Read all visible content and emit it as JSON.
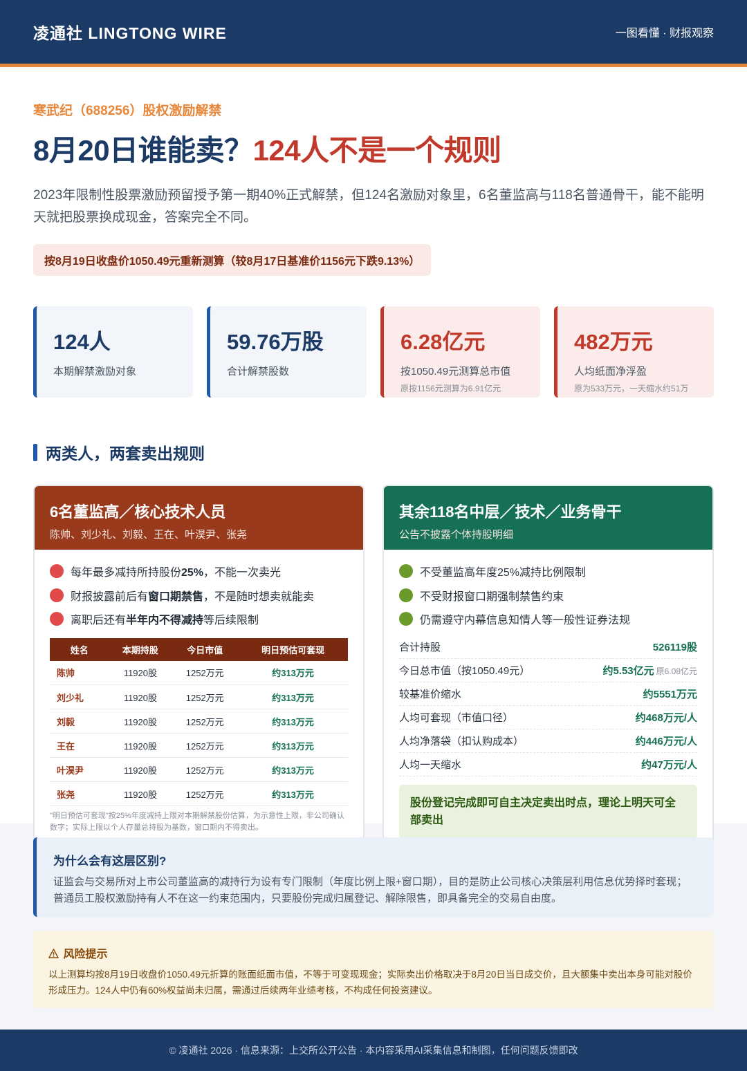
{
  "header": {
    "brand": "凌通社 LINGTONG WIRE",
    "tagline": "一图看懂 · 财报观察"
  },
  "hero": {
    "kicker": "寒武纪（688256）股权激励解禁",
    "headline_main": "8月20日谁能卖？",
    "headline_accent": "124人不是一个规则",
    "lede": "2023年限制性股票激励预留授予第一期40%正式解禁，但124名激励对象里，6名董监高与118名普通骨干，能不能明天就把股票换成现金，答案完全不同。",
    "note": "按8月19日收盘价1050.49元重新测算（较8月17日基准价1156元下跌9.13%）"
  },
  "stats": [
    {
      "value": "124人",
      "label": "本期解禁激励对象",
      "sub": ""
    },
    {
      "value": "59.76万股",
      "label": "合计解禁股数",
      "sub": ""
    },
    {
      "value": "6.28亿元",
      "label": "按1050.49元测算总市值",
      "sub": "原按1156元测算为6.91亿元"
    },
    {
      "value": "482万元",
      "label": "人均纸面净浮盈",
      "sub": "原为533万元，一天缩水约51万"
    }
  ],
  "section_title": "两类人，两套卖出规则",
  "left_card": {
    "title": "6名董监高／核心技术人员",
    "subtitle": "陈帅、刘少礼、刘毅、王在、叶淏尹、张尧",
    "bullets": [
      {
        "pre": "每年最多减持所持股份",
        "bold": "25%",
        "post": "，不能一次卖光"
      },
      {
        "pre": "财报披露前后有",
        "bold": "窗口期禁售",
        "post": "，不是随时想卖就能卖"
      },
      {
        "pre": "离职后还有",
        "bold": "半年内不得减持",
        "post": "等后续限制"
      }
    ],
    "table_headers": [
      "姓名",
      "本期持股",
      "今日市值",
      "明日预估可套现"
    ],
    "table_rows": [
      {
        "name": "陈帅",
        "shares": "11920股",
        "value": "1252万元",
        "cash": "约313万元"
      },
      {
        "name": "刘少礼",
        "shares": "11920股",
        "value": "1252万元",
        "cash": "约313万元"
      },
      {
        "name": "刘毅",
        "shares": "11920股",
        "value": "1252万元",
        "cash": "约313万元"
      },
      {
        "name": "王在",
        "shares": "11920股",
        "value": "1252万元",
        "cash": "约313万元"
      },
      {
        "name": "叶淏尹",
        "shares": "11920股",
        "value": "1252万元",
        "cash": "约313万元"
      },
      {
        "name": "张尧",
        "shares": "11920股",
        "value": "1252万元",
        "cash": "约313万元"
      }
    ],
    "table_note": "\"明日预估可套现\"按25%年度减持上限对本期解禁股份估算，为示意性上限，非公司确认数字；实际上限以个人存量总持股为基数，窗口期内不得卖出。"
  },
  "right_card": {
    "title": "其余118名中层／技术／业务骨干",
    "subtitle": "公告不披露个体持股明细",
    "bullets": [
      "不受董监高年度25%减持比例限制",
      "不受财报窗口期强制禁售约束",
      "仍需遵守内幕信息知情人等一般性证券法规"
    ],
    "metrics": [
      {
        "label": "合计持股",
        "value": "526119股",
        "note": ""
      },
      {
        "label": "今日总市值（按1050.49元）",
        "value": "约5.53亿元",
        "note": "原6.08亿元"
      },
      {
        "label": "较基准价缩水",
        "value": "约5551万元",
        "note": ""
      },
      {
        "label": "人均可套现（市值口径）",
        "value": "约468万元/人",
        "note": ""
      },
      {
        "label": "人均净落袋（扣认购成本）",
        "value": "约446万元/人",
        "note": ""
      },
      {
        "label": "人均一天缩水",
        "value": "约47万元/人",
        "note": ""
      }
    ],
    "callout": "股份登记完成即可自主决定卖出时点，理论上明天可全部卖出"
  },
  "why": {
    "title": "为什么会有这层区别?",
    "text": "证监会与交易所对上市公司董监高的减持行为设有专门限制（年度比例上限+窗口期），目的是防止公司核心决策层利用信息优势择时套现；普通员工股权激励持有人不在这一约束范围内，只要股份完成归属登记、解除限售，即具备完全的交易自由度。"
  },
  "risk": {
    "icon": "warning-icon",
    "title": "风险提示",
    "text": "以上测算均按8月19日收盘价1050.49元折算的账面纸面市值，不等于可变现现金；实际卖出价格取决于8月20日当日成交价，且大额集中卖出本身可能对股价形成压力。124人中仍有60%权益尚未归属，需通过后续两年业绩考核，不构成任何投资建议。"
  },
  "footer": "© 凌通社 2026 · 信息来源：上交所公开公告 · 本内容采用AI采集信息和制图，任何问题反馈即改",
  "colors": {
    "navy": "#1b3a66",
    "orange": "#e8873a",
    "red": "#c0392b",
    "brown": "#9a3a1c",
    "green": "#157055"
  }
}
